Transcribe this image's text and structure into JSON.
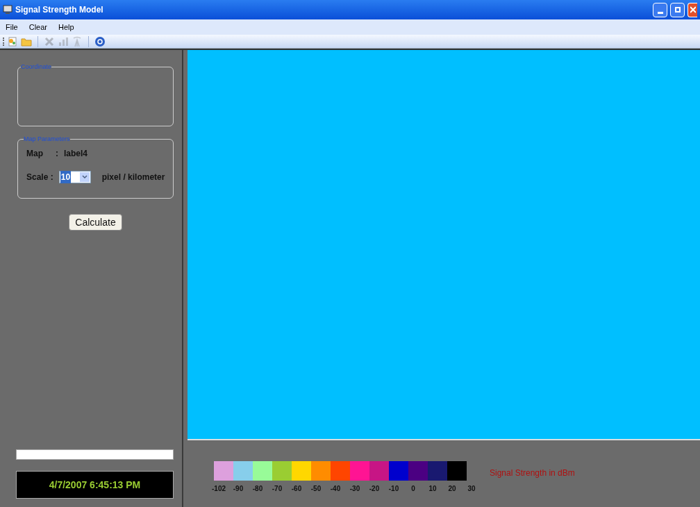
{
  "window": {
    "title": "Signal Strength Model"
  },
  "menu": [
    "File",
    "Clear",
    "Help"
  ],
  "toolbar": [
    {
      "kind": "new",
      "disabled": false
    },
    {
      "kind": "open",
      "disabled": false
    },
    {
      "kind": "sep"
    },
    {
      "kind": "delete",
      "disabled": true
    },
    {
      "kind": "chart",
      "disabled": true
    },
    {
      "kind": "antenna",
      "disabled": true
    },
    {
      "kind": "sep"
    },
    {
      "kind": "help",
      "disabled": false
    }
  ],
  "coordinate": {
    "title": "Coordinate"
  },
  "map_parameters": {
    "title": "Map Parameters",
    "map_label": "Map",
    "map_sep": ":",
    "map_value": "label4",
    "scale_label": "Scale :",
    "scale_value": "10",
    "scale_unit": "pixel / kilometer"
  },
  "calculate_button": "Calculate",
  "progress": {
    "level": 0
  },
  "clock": "4/7/2007 6:45:13 PM",
  "legend": {
    "title": "Signal Strength in dBm",
    "swatches": [
      {
        "color": "#dda0dd"
      },
      {
        "color": "#87ceeb"
      },
      {
        "color": "#98fb98"
      },
      {
        "color": "#9acd32"
      },
      {
        "color": "#ffd700"
      },
      {
        "color": "#ff8c00"
      },
      {
        "color": "#ff4500"
      },
      {
        "color": "#ff1493"
      },
      {
        "color": "#c71585"
      },
      {
        "color": "#0000cd"
      },
      {
        "color": "#4b0082"
      },
      {
        "color": "#191970"
      },
      {
        "color": "#000000"
      }
    ],
    "ticks": [
      "-102",
      "-90",
      "-80",
      "-70",
      "-60",
      "-50",
      "-40",
      "-30",
      "-20",
      "-10",
      "0",
      "10",
      "20",
      "30"
    ]
  }
}
